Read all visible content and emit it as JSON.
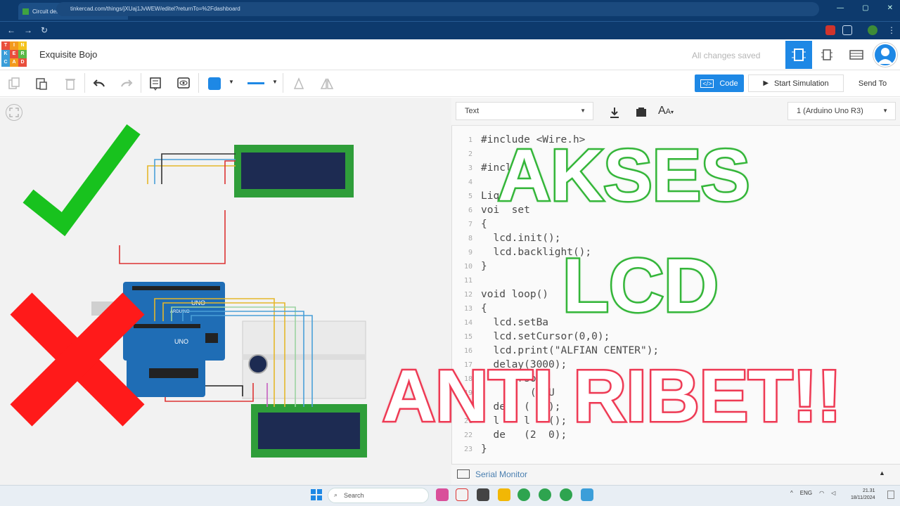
{
  "browser": {
    "tab_title": "Circuit design Exquisite Bojo - T",
    "tab_close": "×",
    "new_tab": "+",
    "url": "tinkercad.com/things/jXUaj1JvWEW/editel?returnTo=%2Fdashboard",
    "window_controls": [
      "⌄",
      "—",
      "▢",
      "✕"
    ]
  },
  "app": {
    "logo_letters": [
      "T",
      "I",
      "N",
      "K",
      "E",
      "R",
      "C",
      "A",
      "D"
    ],
    "logo_colors": [
      "#e94e3c",
      "#f39a1e",
      "#f4c21b",
      "#3b9ed9",
      "#e94e3c",
      "#5ab947",
      "#3b9ed9",
      "#f39a1e",
      "#e94e3c"
    ],
    "project_name": "Exquisite Bojo",
    "save_status": "All changes saved",
    "accent": "#1e88e5"
  },
  "toolbar": {
    "code_label": "Code",
    "start_sim_label": "Start Simulation",
    "send_to_label": "Send To"
  },
  "code_panel": {
    "mode": "Text",
    "device": "1 (Arduino Uno R3)",
    "lines": [
      {
        "n": "1",
        "text": "#include <Wire.h>"
      },
      {
        "n": "2",
        "text": ""
      },
      {
        "n": "3",
        "text": "#incl       <L"
      },
      {
        "n": "4",
        "text": ""
      },
      {
        "n": "5",
        "text": "Liq"
      },
      {
        "n": "6",
        "text": "voi  set"
      },
      {
        "n": "7",
        "text": "{"
      },
      {
        "n": "8",
        "text": "  lcd.init();"
      },
      {
        "n": "9",
        "text": "  lcd.backlight();"
      },
      {
        "n": "10",
        "text": "}"
      },
      {
        "n": "11",
        "text": ""
      },
      {
        "n": "12",
        "text": "void loop()"
      },
      {
        "n": "13",
        "text": "{"
      },
      {
        "n": "14",
        "text": "  lcd.setBa"
      },
      {
        "n": "15",
        "text": "  lcd.setCursor(0,0);"
      },
      {
        "n": "16",
        "text": "  lcd.print(\"ALFIAN CENTER\");"
      },
      {
        "n": "17",
        "text": "  delay(3000);"
      },
      {
        "n": "18",
        "text": "      rsor"
      },
      {
        "n": "19",
        "text": "        (\"SU"
      },
      {
        "n": "20",
        "text": "  de   (  0);"
      },
      {
        "n": "21",
        "text": "  l    l   ();"
      },
      {
        "n": "22",
        "text": "  de   (2  0);"
      },
      {
        "n": "23",
        "text": "}"
      }
    ],
    "serial_monitor_label": "Serial Monitor"
  },
  "overlay": {
    "line1": "AKSES",
    "line2": "LCD",
    "line3": "ANTI RIBET!!",
    "green": "#35b63a",
    "red": "#ee3b55"
  },
  "circuits": {
    "board_label": "UNO",
    "board_brand": "ARDUINO"
  },
  "taskbar": {
    "search_placeholder": "Search",
    "lang": "ENG",
    "time": "21.31",
    "date": "18/11/2024"
  }
}
